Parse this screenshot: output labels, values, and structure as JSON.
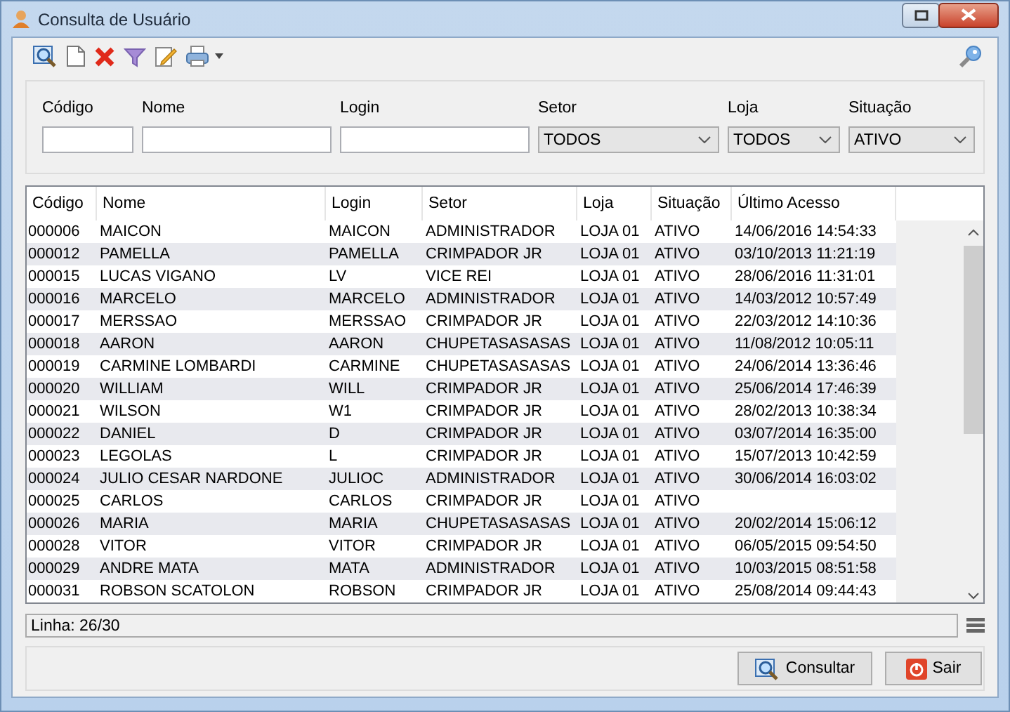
{
  "window": {
    "title": "Consulta de Usuário"
  },
  "filters": [
    {
      "kind": "text",
      "label": "Código"
    },
    {
      "kind": "text",
      "label": "Nome"
    },
    {
      "kind": "text",
      "label": "Login"
    },
    {
      "kind": "select",
      "label": "Setor",
      "value": "TODOS"
    },
    {
      "kind": "select",
      "label": "Loja",
      "value": "TODOS"
    },
    {
      "kind": "select",
      "label": "Situação",
      "value": "ATIVO"
    }
  ],
  "table": {
    "columns": [
      "Código",
      "Nome",
      "Login",
      "Setor",
      "Loja",
      "Situação",
      "Último Acesso"
    ],
    "rows": [
      [
        "000006",
        "MAICON",
        "MAICON",
        "ADMINISTRADOR",
        "LOJA 01",
        "ATIVO",
        "14/06/2016 14:54:33"
      ],
      [
        "000012",
        "PAMELLA",
        "PAMELLA",
        "CRIMPADOR JR",
        "LOJA 01",
        "ATIVO",
        "03/10/2013 11:21:19"
      ],
      [
        "000015",
        "LUCAS VIGANO",
        "LV",
        "VICE REI",
        "LOJA 01",
        "ATIVO",
        "28/06/2016 11:31:01"
      ],
      [
        "000016",
        "MARCELO",
        "MARCELO",
        "ADMINISTRADOR",
        "LOJA 01",
        "ATIVO",
        "14/03/2012 10:57:49"
      ],
      [
        "000017",
        "MERSSAO",
        "MERSSAO",
        "CRIMPADOR JR",
        "LOJA 01",
        "ATIVO",
        "22/03/2012 14:10:36"
      ],
      [
        "000018",
        "AARON",
        "AARON",
        "CHUPETASASASAS",
        "LOJA 01",
        "ATIVO",
        "11/08/2012 10:05:11"
      ],
      [
        "000019",
        "CARMINE LOMBARDI",
        "CARMINE",
        "CHUPETASASASAS",
        "LOJA 01",
        "ATIVO",
        "24/06/2014 13:36:46"
      ],
      [
        "000020",
        "WILLIAM",
        "WILL",
        "CRIMPADOR JR",
        "LOJA 01",
        "ATIVO",
        "25/06/2014 17:46:39"
      ],
      [
        "000021",
        "WILSON",
        "W1",
        "CRIMPADOR JR",
        "LOJA 01",
        "ATIVO",
        "28/02/2013 10:38:34"
      ],
      [
        "000022",
        "DANIEL",
        "D",
        "CRIMPADOR JR",
        "LOJA 01",
        "ATIVO",
        "03/07/2014 16:35:00"
      ],
      [
        "000023",
        "LEGOLAS",
        "L",
        "CRIMPADOR JR",
        "LOJA 01",
        "ATIVO",
        "15/07/2013 10:42:59"
      ],
      [
        "000024",
        "JULIO CESAR NARDONE",
        "JULIOC",
        "ADMINISTRADOR",
        "LOJA 01",
        "ATIVO",
        "30/06/2014 16:03:02"
      ],
      [
        "000025",
        "CARLOS",
        "CARLOS",
        "CRIMPADOR JR",
        "LOJA 01",
        "ATIVO",
        ""
      ],
      [
        "000026",
        "MARIA",
        "MARIA",
        "CHUPETASASASAS",
        "LOJA 01",
        "ATIVO",
        "20/02/2014 15:06:12"
      ],
      [
        "000028",
        "VITOR",
        "VITOR",
        "CRIMPADOR JR",
        "LOJA 01",
        "ATIVO",
        "06/05/2015 09:54:50"
      ],
      [
        "000029",
        "ANDRE MATA",
        "MATA",
        "ADMINISTRADOR",
        "LOJA 01",
        "ATIVO",
        "10/03/2015 08:51:58"
      ],
      [
        "000031",
        "ROBSON SCATOLON",
        "ROBSON",
        "CRIMPADOR JR",
        "LOJA 01",
        "ATIVO",
        "25/08/2014 09:44:43"
      ]
    ]
  },
  "status_bar": {
    "text": "Linha: 26/30"
  },
  "buttons": [
    {
      "kind": "search",
      "label": "Consultar"
    },
    {
      "kind": "exit",
      "label": "Sair"
    }
  ]
}
